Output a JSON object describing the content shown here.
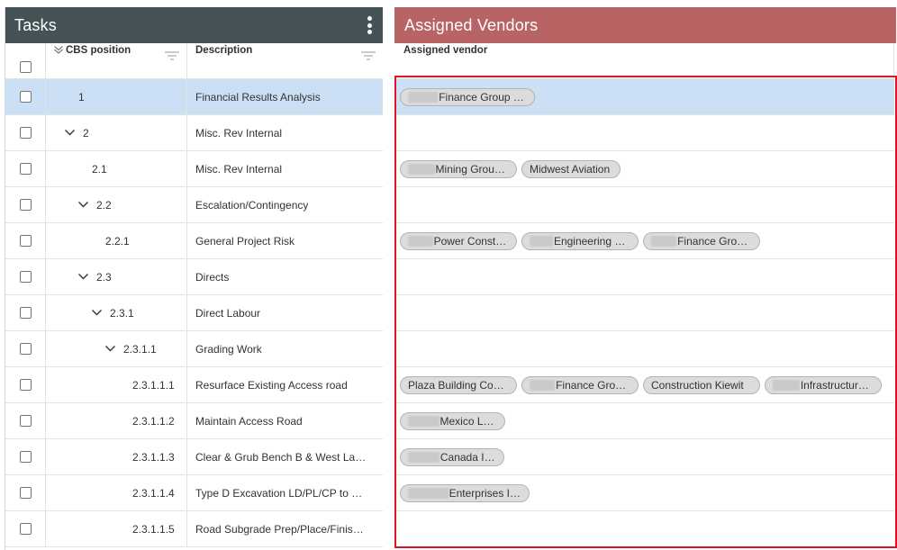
{
  "tasks": {
    "title": "Tasks",
    "columns": {
      "cbs": "CBS position",
      "description": "Description"
    },
    "rows": [
      {
        "cbs": "1",
        "description": "Financial Results Analysis",
        "level": 0,
        "expandable": false,
        "selected": true
      },
      {
        "cbs": "2",
        "description": "Misc. Rev Internal",
        "level": 0,
        "expandable": true,
        "selected": false
      },
      {
        "cbs": "2.1",
        "description": "Misc. Rev Internal",
        "level": 1,
        "expandable": false,
        "selected": false
      },
      {
        "cbs": "2.2",
        "description": "Escalation/Contingency",
        "level": 1,
        "expandable": true,
        "selected": false
      },
      {
        "cbs": "2.2.1",
        "description": "General Project Risk",
        "level": 2,
        "expandable": false,
        "selected": false
      },
      {
        "cbs": "2.3",
        "description": "Directs",
        "level": 1,
        "expandable": true,
        "selected": false
      },
      {
        "cbs": "2.3.1",
        "description": "Direct Labour",
        "level": 2,
        "expandable": true,
        "selected": false
      },
      {
        "cbs": "2.3.1.1",
        "description": "Grading Work",
        "level": 3,
        "expandable": true,
        "selected": false
      },
      {
        "cbs": "2.3.1.1.1",
        "description": "Resurface Existing Access road",
        "level": 4,
        "expandable": false,
        "selected": false
      },
      {
        "cbs": "2.3.1.1.2",
        "description": "Maintain Access Road",
        "level": 4,
        "expandable": false,
        "selected": false
      },
      {
        "cbs": "2.3.1.1.3",
        "description": "Clear & Grub Bench B & West Laydown",
        "level": 4,
        "expandable": false,
        "selected": false
      },
      {
        "cbs": "2.3.1.1.4",
        "description": "Type D Excavation LD/PL/CP to Elevation",
        "level": 4,
        "expandable": false,
        "selected": false
      },
      {
        "cbs": "2.3.1.1.5",
        "description": "Road Subgrade Prep/Place/Finish Work",
        "level": 4,
        "expandable": false,
        "selected": false
      }
    ]
  },
  "vendors": {
    "title": "Assigned Vendors",
    "column": "Assigned vendor",
    "rows": [
      {
        "selected": true,
        "chips": [
          {
            "text": "Finance Group Inc.",
            "redacted": true
          }
        ]
      },
      {
        "selected": false,
        "chips": []
      },
      {
        "selected": false,
        "chips": [
          {
            "text": "Mining Group Ltd.",
            "redacted": true
          },
          {
            "text": "Midwest Aviation",
            "redacted": false
          }
        ]
      },
      {
        "selected": false,
        "chips": []
      },
      {
        "selected": false,
        "chips": [
          {
            "text": "Power Construction",
            "redacted": true
          },
          {
            "text": "Engineering Services",
            "redacted": true
          },
          {
            "text": "Finance Group Inc.",
            "redacted": true
          }
        ]
      },
      {
        "selected": false,
        "chips": []
      },
      {
        "selected": false,
        "chips": []
      },
      {
        "selected": false,
        "chips": []
      },
      {
        "selected": false,
        "chips": [
          {
            "text": "Plaza Building Construction",
            "redacted": false
          },
          {
            "text": "Finance Group Inc.",
            "redacted": true
          },
          {
            "text": "Construction Kiewit",
            "redacted": false
          },
          {
            "text": "Infrastructure Ltd.",
            "redacted": true
          }
        ]
      },
      {
        "selected": false,
        "chips": [
          {
            "text": "Mexico LLC",
            "redacted": true
          }
        ]
      },
      {
        "selected": false,
        "chips": [
          {
            "text": "Canada Inc",
            "redacted": true
          }
        ]
      },
      {
        "selected": false,
        "chips": [
          {
            "text": "Enterprises Inc",
            "redacted": true
          }
        ]
      },
      {
        "selected": false,
        "chips": []
      }
    ]
  },
  "colors": {
    "tasks_header": "#445255",
    "vendors_header": "#b96464",
    "selected_row": "#cce0f5",
    "highlight_border": "#e0141e"
  }
}
